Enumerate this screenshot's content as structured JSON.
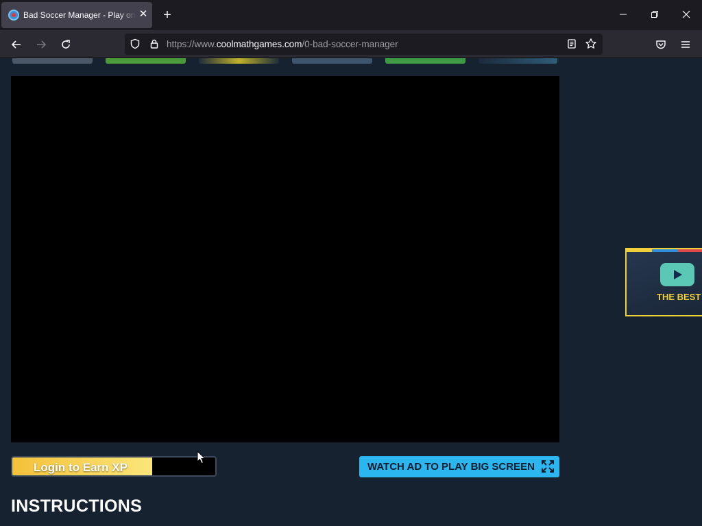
{
  "browser": {
    "tab": {
      "title": "Bad Soccer Manager - Play online"
    },
    "url": {
      "prefix": "https://www.",
      "host": "coolmathgames.com",
      "path": "/0-bad-soccer-manager"
    }
  },
  "page": {
    "xp": {
      "label": "Login to Earn XP",
      "progress": 0.69
    },
    "watch_ad": {
      "label": "WATCH AD TO PLAY BIG SCREEN"
    },
    "instructions_heading": "INSTRUCTIONS",
    "side_ad": {
      "text": "THE BEST"
    }
  },
  "colors": {
    "page_bg": "#172231",
    "watch_ad_bg": "#2cb6f0",
    "xp_fill": "#f4c13a",
    "ad_border": "#f2d03a"
  }
}
